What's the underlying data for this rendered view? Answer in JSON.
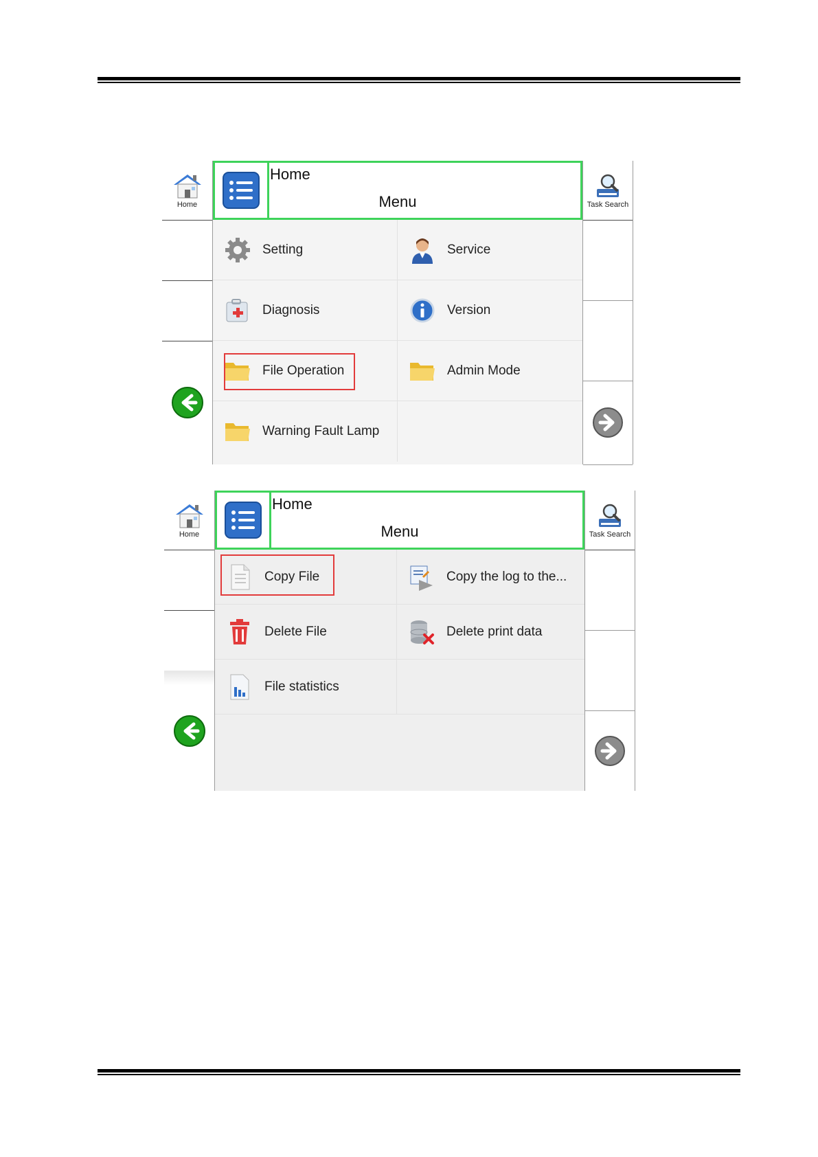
{
  "screen1": {
    "home_label": "Home",
    "task_search_label": "Task Search",
    "title": "Home",
    "subtitle": "Menu",
    "items": [
      {
        "label": "Setting",
        "icon": "gear-icon"
      },
      {
        "label": "Service",
        "icon": "service-person-icon"
      },
      {
        "label": "Diagnosis",
        "icon": "first-aid-kit-icon"
      },
      {
        "label": "Version",
        "icon": "info-icon"
      },
      {
        "label": "File Operation",
        "icon": "folder-icon",
        "highlighted": true
      },
      {
        "label": "Admin Mode",
        "icon": "folder-icon"
      },
      {
        "label": "Warning Fault Lamp",
        "icon": "folder-icon"
      }
    ]
  },
  "screen2": {
    "home_label": "Home",
    "task_search_label": "Task Search",
    "title": "Home",
    "subtitle": "Menu",
    "items": [
      {
        "label": "Copy File",
        "icon": "document-icon",
        "highlighted": true
      },
      {
        "label": "Copy the log to the...",
        "icon": "log-copy-icon"
      },
      {
        "label": "Delete File",
        "icon": "trash-icon"
      },
      {
        "label": "Delete print data",
        "icon": "database-delete-icon"
      },
      {
        "label": "File statistics",
        "icon": "statistics-icon"
      }
    ]
  },
  "colors": {
    "header_border": "#3ed35a",
    "highlight": "#e23b3b",
    "menu_button": "#2f6fc8",
    "back_arrow": "#1fa31f"
  }
}
